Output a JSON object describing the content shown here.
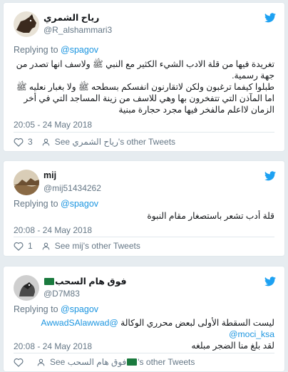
{
  "colors": {
    "background": "#e6ecf0",
    "card": "#ffffff",
    "link": "#1b95e0",
    "muted": "#657786",
    "twitter_blue": "#1da1f2"
  },
  "tweets": [
    {
      "name": "رياح الشمري",
      "handle": "@R_alshammari3",
      "reply_prefix": "Replying to",
      "reply_to": "@spagov",
      "text_lines": [
        "تغريدة فيها من قلة الادب الشيء الكثير مع النبي ﷺ ولاسف انها تصدر من جهة رسمية.",
        "طبلوا كيفما ترغبون ولكن لاتقارنون انفسكم بسطحه ﷺ ولا بغبار نعليه ﷺ",
        "اما المآذن التي تتفخرون بها وهي للاسف من زينة المساجد التي في أخر الزمان لااعلم مالفخر فيها مجرد حجارة مبنية"
      ],
      "timestamp": "20:05 - 24 May 2018",
      "like_count": "3",
      "see_prefix": "See",
      "see_name": "رياح الشمري",
      "see_suffix": "'s other Tweets"
    },
    {
      "name": "mij",
      "handle": "@mij51434262",
      "reply_prefix": "Replying to",
      "reply_to": "@spagov",
      "text_lines": [
        "قلة أدب تشعر باستصغار مقام النبوة"
      ],
      "timestamp": "20:08 - 24 May 2018",
      "like_count": "1",
      "see_prefix": "See",
      "see_name": "mij",
      "see_suffix": "'s other Tweets"
    },
    {
      "name": "فوق هام السحب",
      "handle": "@D7M83",
      "reply_prefix": "Replying to",
      "reply_to": "@spagov",
      "text_lines": [
        "ليست السقطة الأولى لبعض محرري الوكالة",
        "لقد بلغ منا الضجر مبلغه"
      ],
      "mentions": [
        "@AwwadSAlawwad",
        "@moci_ksa"
      ],
      "timestamp": "20:08 - 24 May 2018",
      "like_count": "",
      "see_prefix": "See",
      "see_name": "فوق هام السحب",
      "see_suffix": "'s other Tweets"
    }
  ]
}
